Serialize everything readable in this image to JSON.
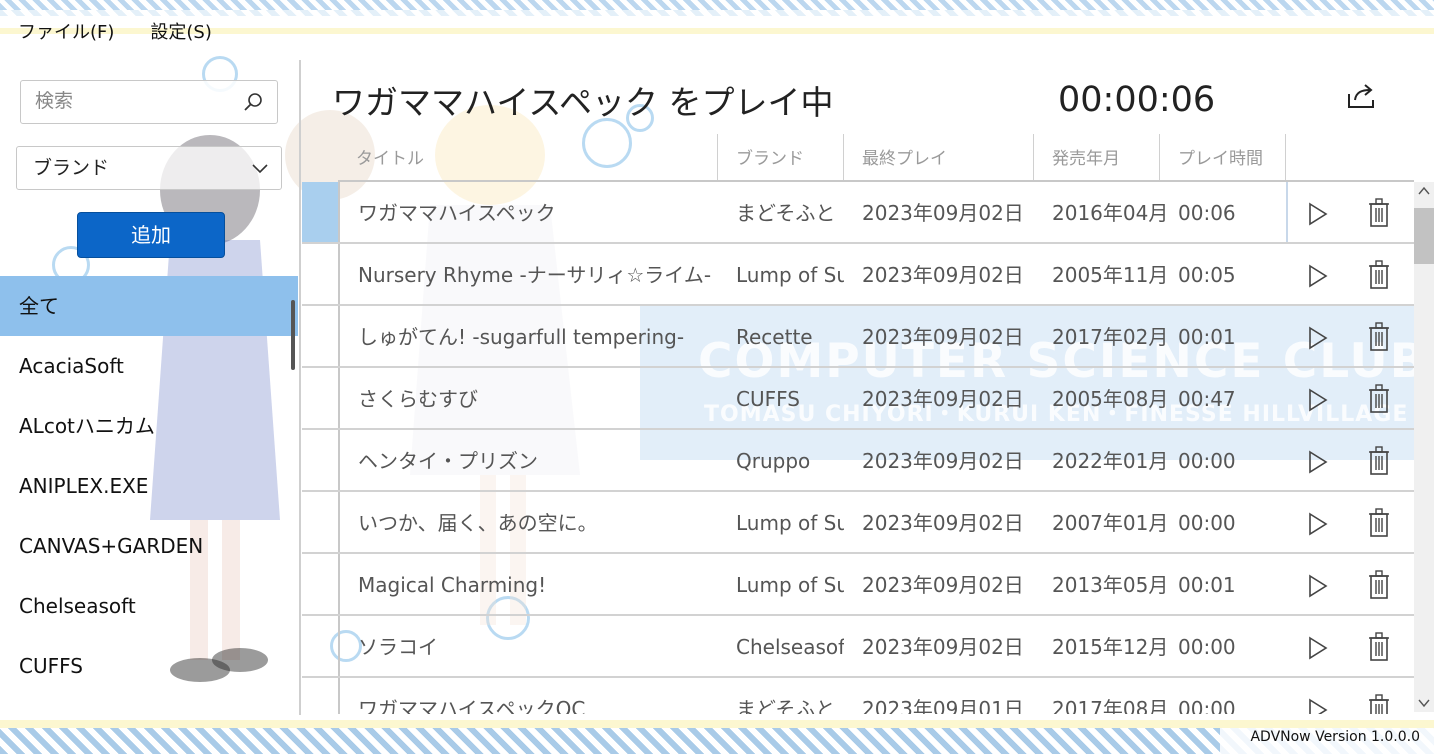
{
  "menu": {
    "file": "ファイル(F)",
    "settings": "設定(S)"
  },
  "sidebar": {
    "search_placeholder": "検索",
    "brand_select": "ブランド",
    "add_label": "追加",
    "brands": [
      {
        "label": "全て",
        "selected": true
      },
      {
        "label": "AcaciaSoft"
      },
      {
        "label": "ALcotハニカム"
      },
      {
        "label": "ANIPLEX.EXE"
      },
      {
        "label": "CANVAS+GARDEN"
      },
      {
        "label": "Chelseasoft"
      },
      {
        "label": "CUFFS"
      }
    ]
  },
  "header": {
    "now_playing": "ワガママハイスペック をプレイ中",
    "elapsed": "00:00:06"
  },
  "table": {
    "columns": {
      "title": "タイトル",
      "brand": "ブランド",
      "last_played": "最終プレイ",
      "release": "発売年月",
      "play_time": "プレイ時間"
    },
    "rows": [
      {
        "title": "ワガママハイスペック",
        "brand": "まどそふと",
        "last_played": "2023年09月02日",
        "release": "2016年04月",
        "play_time": "00:06",
        "selected": true
      },
      {
        "title": "Nursery Rhyme -ナーサリィ☆ライム-",
        "brand": "Lump of Sugar",
        "last_played": "2023年09月02日",
        "release": "2005年11月",
        "play_time": "00:05"
      },
      {
        "title": "しゅがてん! -sugarfull tempering-",
        "brand": "Recette",
        "last_played": "2023年09月02日",
        "release": "2017年02月",
        "play_time": "00:01"
      },
      {
        "title": "さくらむすび",
        "brand": "CUFFS",
        "last_played": "2023年09月02日",
        "release": "2005年08月",
        "play_time": "00:47"
      },
      {
        "title": "ヘンタイ・プリズン",
        "brand": "Qruppo",
        "last_played": "2023年09月02日",
        "release": "2022年01月",
        "play_time": "00:00"
      },
      {
        "title": "いつか、届く、あの空に。",
        "brand": "Lump of Sugar",
        "last_played": "2023年09月02日",
        "release": "2007年01月",
        "play_time": "00:00"
      },
      {
        "title": "Magical Charming!",
        "brand": "Lump of Sugar",
        "last_played": "2023年09月02日",
        "release": "2013年05月",
        "play_time": "00:01"
      },
      {
        "title": "ソラコイ",
        "brand": "Chelseasoft",
        "last_played": "2023年09月02日",
        "release": "2015年12月",
        "play_time": "00:00"
      },
      {
        "title": "ワガママハイスペックOC",
        "brand": "まどそふと",
        "last_played": "2023年09月01日",
        "release": "2017年08月",
        "play_time": "00:00"
      }
    ]
  },
  "banner": {
    "line1": "COMPUTER SCIENCE CLUB",
    "line2": "TOMASU CHIYORI・KURUI KEN・FINESSE HILLVILLAGE"
  },
  "footer": {
    "version": "ADVNow Version 1.0.0.0"
  },
  "colors": {
    "accent": "#0c66c8",
    "selected_bg": "#8ec0ec",
    "stripe": "#a9cbe8"
  },
  "icons": {
    "search": "search-icon",
    "dropdown": "chevron-down-icon",
    "share": "share-icon",
    "play": "play-icon",
    "delete": "trash-icon"
  }
}
